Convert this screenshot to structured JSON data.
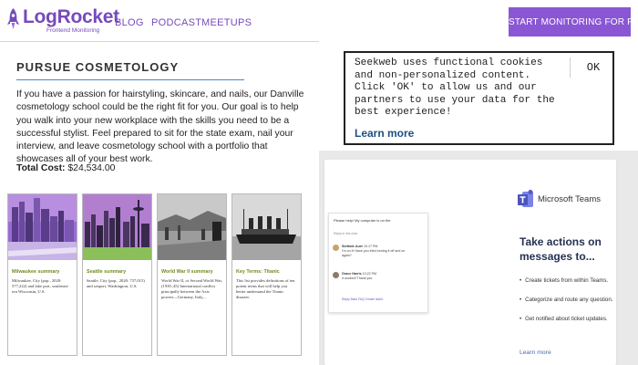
{
  "header": {
    "logo_name": "LogRocket",
    "logo_subtitle": "Frontend Monitoring",
    "nav": {
      "blog": "BLOG",
      "podcast": "PODCAST",
      "meetups": "MEETUPS"
    },
    "cta_label": "START MONITORING FOR FREE",
    "brand_color": "#764abc",
    "cta_color": "#8a56d4"
  },
  "article": {
    "title": "PURSUE COSMETOLOGY",
    "body": "If you have a passion for hairstyling, skincare, and nails, our Danville cosmetology school could be the right fit for you. Our goal is to help you walk into your new workplace with the skills you need to be a successful stylist. Feel prepared to sit for the state exam, nail your interview, and leave cosmetology school with a portfolio that showcases all of your best work.",
    "cost_label": "Total Cost:",
    "cost_value": "$24,534.00"
  },
  "cards": [
    {
      "title": "Milwaukee summary",
      "desc": "Milwaukee, City (pop., 2020: 577,222) and lake port, southeast-ern Wisconsin, U.S.",
      "image": "milwaukee-skyline-image"
    },
    {
      "title": "Seattle summary",
      "desc": "Seattle, City (pop., 2020: 737,015) and seaport, Washington, U.S.",
      "image": "seattle-skyline-image"
    },
    {
      "title": "World War II summary",
      "desc": "World War II, or Second World War, (1939–45) International conflict principally between the Axis powers—Germany, Italy,...",
      "image": "world-war-ii-image"
    },
    {
      "title": "Key Terms: Titanic",
      "desc": "This list provides definitions of ten potent terms that will help you better understand the Titanic disaster.",
      "image": "titanic-ship-image"
    }
  ],
  "cookie": {
    "text": "Seekweb uses functional cookies and non-personalized content. Click 'OK' to allow us and our partners to use your data for the best experience!",
    "link": "Learn more",
    "ok": "OK"
  },
  "ad": {
    "brand": "Microsoft Teams",
    "headline": "Take actions on messages to...",
    "bullets": [
      "Create tickets from within Teams.",
      "Categorize and route any question.",
      "Get notified about ticket updates."
    ],
    "learn_more": "Learn more",
    "chat": {
      "header": "Please help! My computer is on fire",
      "subheader": "Reply in this chat",
      "messages": [
        {
          "name": "Stefanie Auer",
          "time": "10:17 PM",
          "text": "I'm on it! Have you tried turning it off and on again?"
        },
        {
          "name": "Grace Harris",
          "time": "10:22 PM",
          "text": "It worked! Thank you."
        }
      ],
      "actions": "Reply   Mark FAQ   Create ticket"
    }
  }
}
